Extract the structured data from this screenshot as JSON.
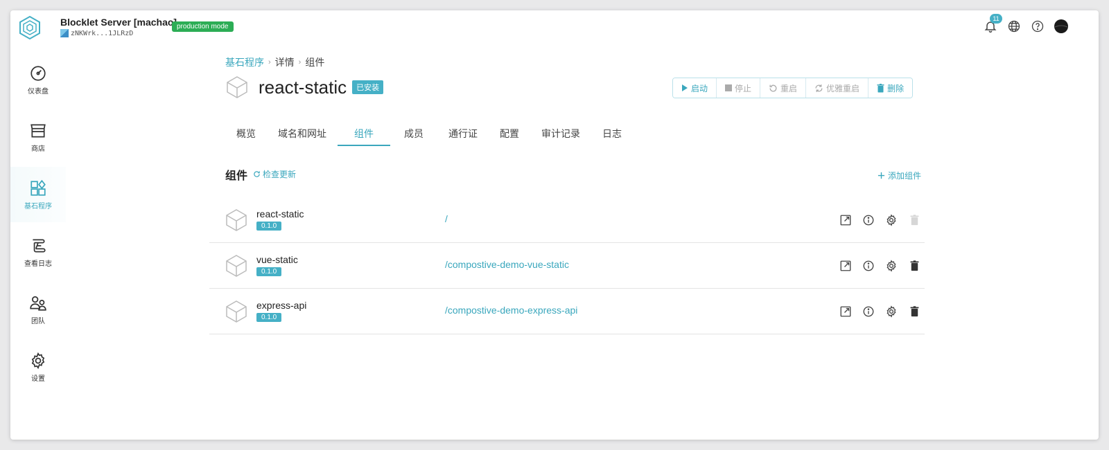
{
  "server": {
    "name": "Blocklet Server [machao]",
    "did": "zNKWrk...1JLRzD",
    "mode": "production mode"
  },
  "header": {
    "notification_count": "11",
    "icons": [
      "bell-icon",
      "globe-icon",
      "help-icon",
      "avatar"
    ]
  },
  "sidebar": {
    "items": [
      {
        "label": "仪表盘",
        "icon": "gauge-icon"
      },
      {
        "label": "商店",
        "icon": "store-icon"
      },
      {
        "label": "基石程序",
        "icon": "blocklets-icon",
        "active": true
      },
      {
        "label": "查看日志",
        "icon": "log-icon"
      },
      {
        "label": "团队",
        "icon": "team-icon"
      },
      {
        "label": "设置",
        "icon": "gear-icon"
      }
    ]
  },
  "breadcrumb": {
    "root": "基石程序",
    "detail": "详情",
    "current": "组件"
  },
  "app": {
    "title": "react-static",
    "status": "已安装"
  },
  "actions": {
    "start": "启动",
    "stop": "停止",
    "restart": "重启",
    "graceful_restart": "优雅重启",
    "delete": "删除"
  },
  "tabs": [
    "概览",
    "域名和网址",
    "组件",
    "成员",
    "通行证",
    "配置",
    "审计记录",
    "日志"
  ],
  "active_tab": "组件",
  "components_section": {
    "title": "组件",
    "check_update": "检查更新",
    "add_component": "添加组件"
  },
  "components": [
    {
      "name": "react-static",
      "version": "0.1.0",
      "mount": "/",
      "delete_disabled": true
    },
    {
      "name": "vue-static",
      "version": "0.1.0",
      "mount": "/compostive-demo-vue-static",
      "delete_disabled": false
    },
    {
      "name": "express-api",
      "version": "0.1.0",
      "mount": "/compostive-demo-express-api",
      "delete_disabled": false
    }
  ],
  "colors": {
    "accent": "#45b0c6",
    "link": "#3aa7bd",
    "mode_badge": "#2cad55"
  }
}
